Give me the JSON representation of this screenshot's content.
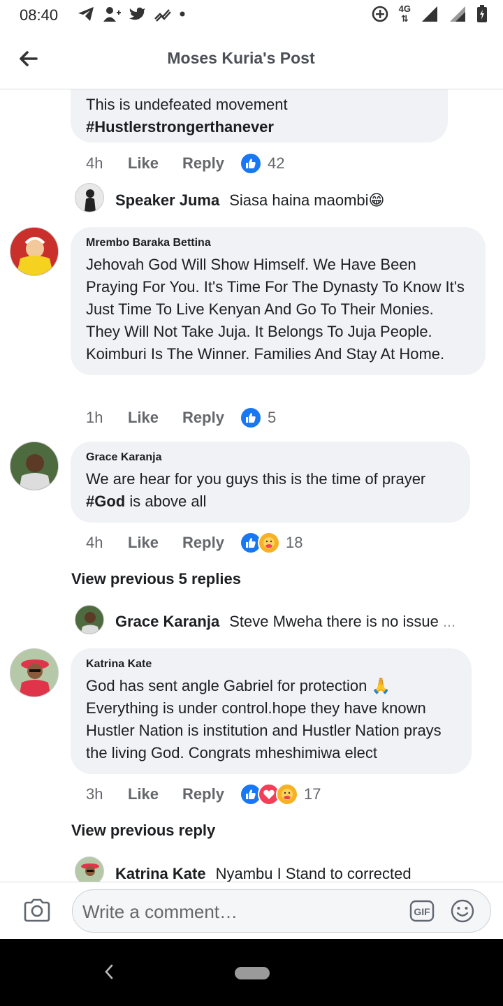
{
  "status_bar": {
    "time": "08:40",
    "network": "4G"
  },
  "header": {
    "title": "Moses Kuria's Post"
  },
  "comments": [
    {
      "text_line1": "This is undefeated movement",
      "hashtag": "#Hustlerstrongerthanever",
      "time": "4h",
      "like": "Like",
      "reply": "Reply",
      "reactions": "42"
    },
    {
      "name": "Mrembo Baraka Bettina",
      "text": "Jehovah God Will Show Himself. We Have Been Praying For You. It's Time For The Dynasty To Know It's Just Time To Live Kenyan And Go To Their Monies. They Will Not Take Juja. It Belongs To Juja People. Koimburi Is The Winner. Families And Stay At Home.",
      "time": "1h",
      "like": "Like",
      "reply": "Reply",
      "reactions": "5"
    },
    {
      "name": "Grace Karanja",
      "text_line1": "We are hear for you guys this is the time of prayer",
      "hashtag": "#God",
      "text_rest": " is above all",
      "time": "4h",
      "like": "Like",
      "reply": "Reply",
      "reactions": "18"
    },
    {
      "name": "Katrina Kate",
      "text": "God has sent angle Gabriel for protection 🙏 Everything is under control.hope they have known Hustler Nation is institution and Hustler Nation prays the living God. Congrats mheshimiwa elect",
      "time": "3h",
      "like": "Like",
      "reply": "Reply",
      "reactions": "17"
    }
  ],
  "replies": [
    {
      "name": "Speaker Juma",
      "text": "Siasa haina maombi😁"
    },
    {
      "name": "Grace Karanja",
      "text": "Steve Mweha there is no issue",
      "ellipsis": "..."
    },
    {
      "name": "Katrina Kate",
      "text": "Nyambu I Stand to corrected"
    }
  ],
  "view_previous": [
    "View previous 5 replies",
    "View previous reply"
  ],
  "composer": {
    "placeholder": "Write a comment…",
    "gif": "GIF"
  },
  "colors": {
    "like": "#1877f2",
    "love": "#f33e58",
    "care": "#f7b125",
    "bubble": "#f0f2f5"
  }
}
